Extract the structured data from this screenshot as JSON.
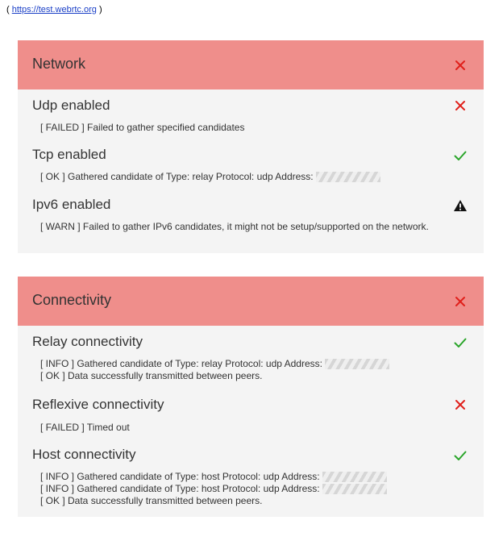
{
  "source": {
    "prefix": "(",
    "link": "https://test.webrtc.org",
    "suffix": ")"
  },
  "colors": {
    "header_bg": "#ef8e8b",
    "panel_bg": "#f4f4f4",
    "fail": "#e0201b",
    "ok": "#2aa52a",
    "warn": "#111111"
  },
  "panels": [
    {
      "title": "Network",
      "status": "close-icon",
      "tests": [
        {
          "title": "Udp enabled",
          "status": "close-icon",
          "log": [
            "[ FAILED ] Failed to gather specified candidates"
          ]
        },
        {
          "title": "Tcp enabled",
          "status": "check-icon",
          "log": [
            "[ OK ] Gathered candidate of Type: relay Protocol: udp Address:"
          ]
        },
        {
          "title": "Ipv6 enabled",
          "status": "warning-icon",
          "log": [
            "[ WARN ] Failed to gather IPv6 candidates, it might not be setup/supported on the network."
          ]
        }
      ]
    },
    {
      "title": "Connectivity",
      "status": "close-icon",
      "tests": [
        {
          "title": "Relay connectivity",
          "status": "check-icon",
          "log": [
            "[ INFO ] Gathered candidate of Type: relay Protocol: udp Address:",
            "[ OK ] Data successfully transmitted between peers."
          ]
        },
        {
          "title": "Reflexive connectivity",
          "status": "close-icon",
          "log": [
            "[ FAILED ] Timed out"
          ]
        },
        {
          "title": "Host connectivity",
          "status": "check-icon",
          "log": [
            "[ INFO ] Gathered candidate of Type: host Protocol: udp Address:",
            "[ INFO ] Gathered candidate of Type: host Protocol: udp Address:",
            "[ OK ] Data successfully transmitted between peers."
          ]
        }
      ]
    }
  ]
}
